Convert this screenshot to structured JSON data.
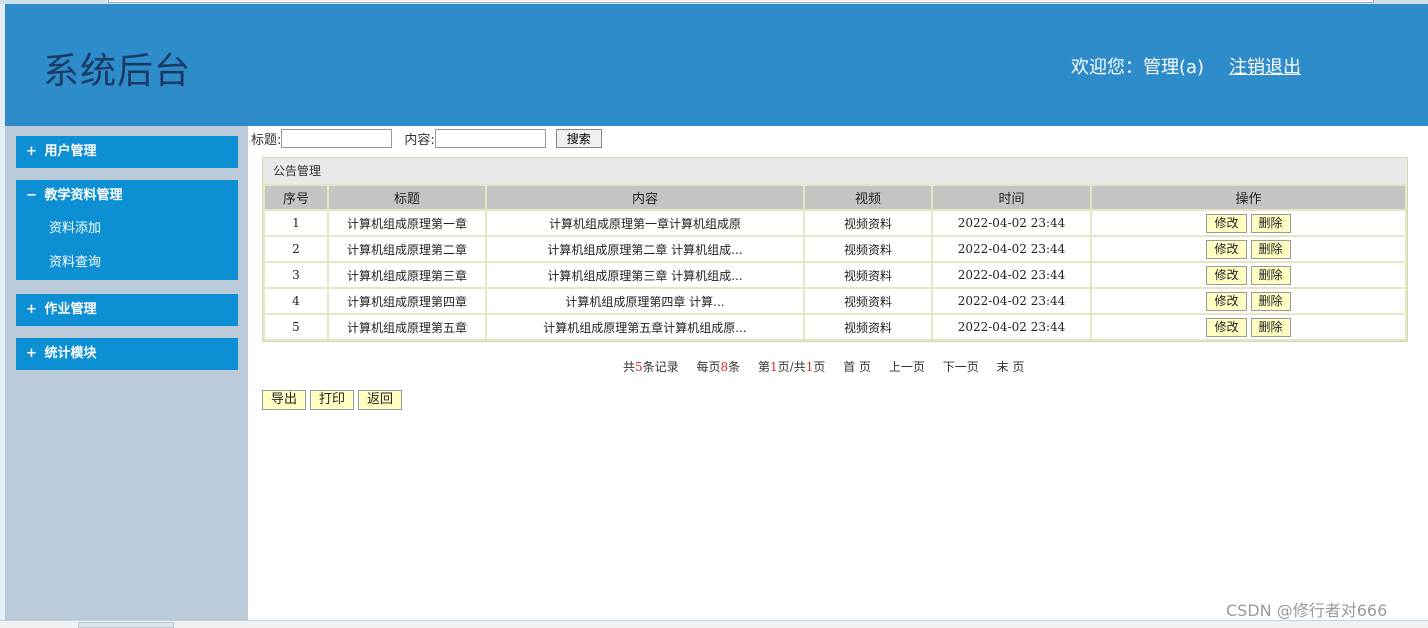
{
  "header": {
    "title": "系统后台",
    "welcome": "欢迎您：管理(a)",
    "logout": "注销退出",
    "bg_color": "#2d8cc9"
  },
  "sidebar": {
    "menus": [
      {
        "sign": "+",
        "label": "用户管理"
      },
      {
        "sign": "−",
        "label": "教学资料管理",
        "subitems": [
          "资料添加",
          "资料查询"
        ]
      },
      {
        "sign": "+",
        "label": "作业管理"
      },
      {
        "sign": "+",
        "label": "统计模块"
      }
    ],
    "menu_color": "#0d8fd3"
  },
  "search": {
    "title_label": "标题:",
    "content_label": "内容:",
    "title_value": "",
    "content_value": "",
    "button": "搜索"
  },
  "panel": {
    "title": "公告管理",
    "columns": [
      "序号",
      "标题",
      "内容",
      "视频",
      "时间",
      "操作"
    ],
    "rows": [
      {
        "no": "1",
        "title": "计算机组成原理第一章",
        "content": "计算机组成原理第一章计算机组成原",
        "video": "视频资料",
        "time": "2022-04-02 23:44"
      },
      {
        "no": "2",
        "title": "计算机组成原理第二章",
        "content": "计算机组成原理第二章 计算机组成...",
        "video": "视频资料",
        "time": "2022-04-02 23:44"
      },
      {
        "no": "3",
        "title": "计算机组成原理第三章",
        "content": "计算机组成原理第三章 计算机组成...",
        "video": "视频资料",
        "time": "2022-04-02 23:44"
      },
      {
        "no": "4",
        "title": "计算机组成原理第四章",
        "content": "计算机组成原理第四章 计算...",
        "video": "视频资料",
        "time": "2022-04-02 23:44"
      },
      {
        "no": "5",
        "title": "计算机组成原理第五章",
        "content": "计算机组成原理第五章计算机组成原...",
        "video": "视频资料",
        "time": "2022-04-02 23:44"
      }
    ],
    "edit_label": "修改",
    "delete_label": "删除"
  },
  "pager": {
    "total_prefix": "共",
    "total": "5",
    "total_suffix": "条记录",
    "per_page_prefix": "每页",
    "per_page": "8",
    "per_page_suffix": "条",
    "page_prefix": "第",
    "page": "1",
    "page_mid": "页/共",
    "pages": "1",
    "page_suffix": "页",
    "first": "首 页",
    "prev": "上一页",
    "next": "下一页",
    "last": "末 页"
  },
  "actions": {
    "export": "导出",
    "print": "打印",
    "back": "返回"
  },
  "watermark": "CSDN @修行者对666"
}
